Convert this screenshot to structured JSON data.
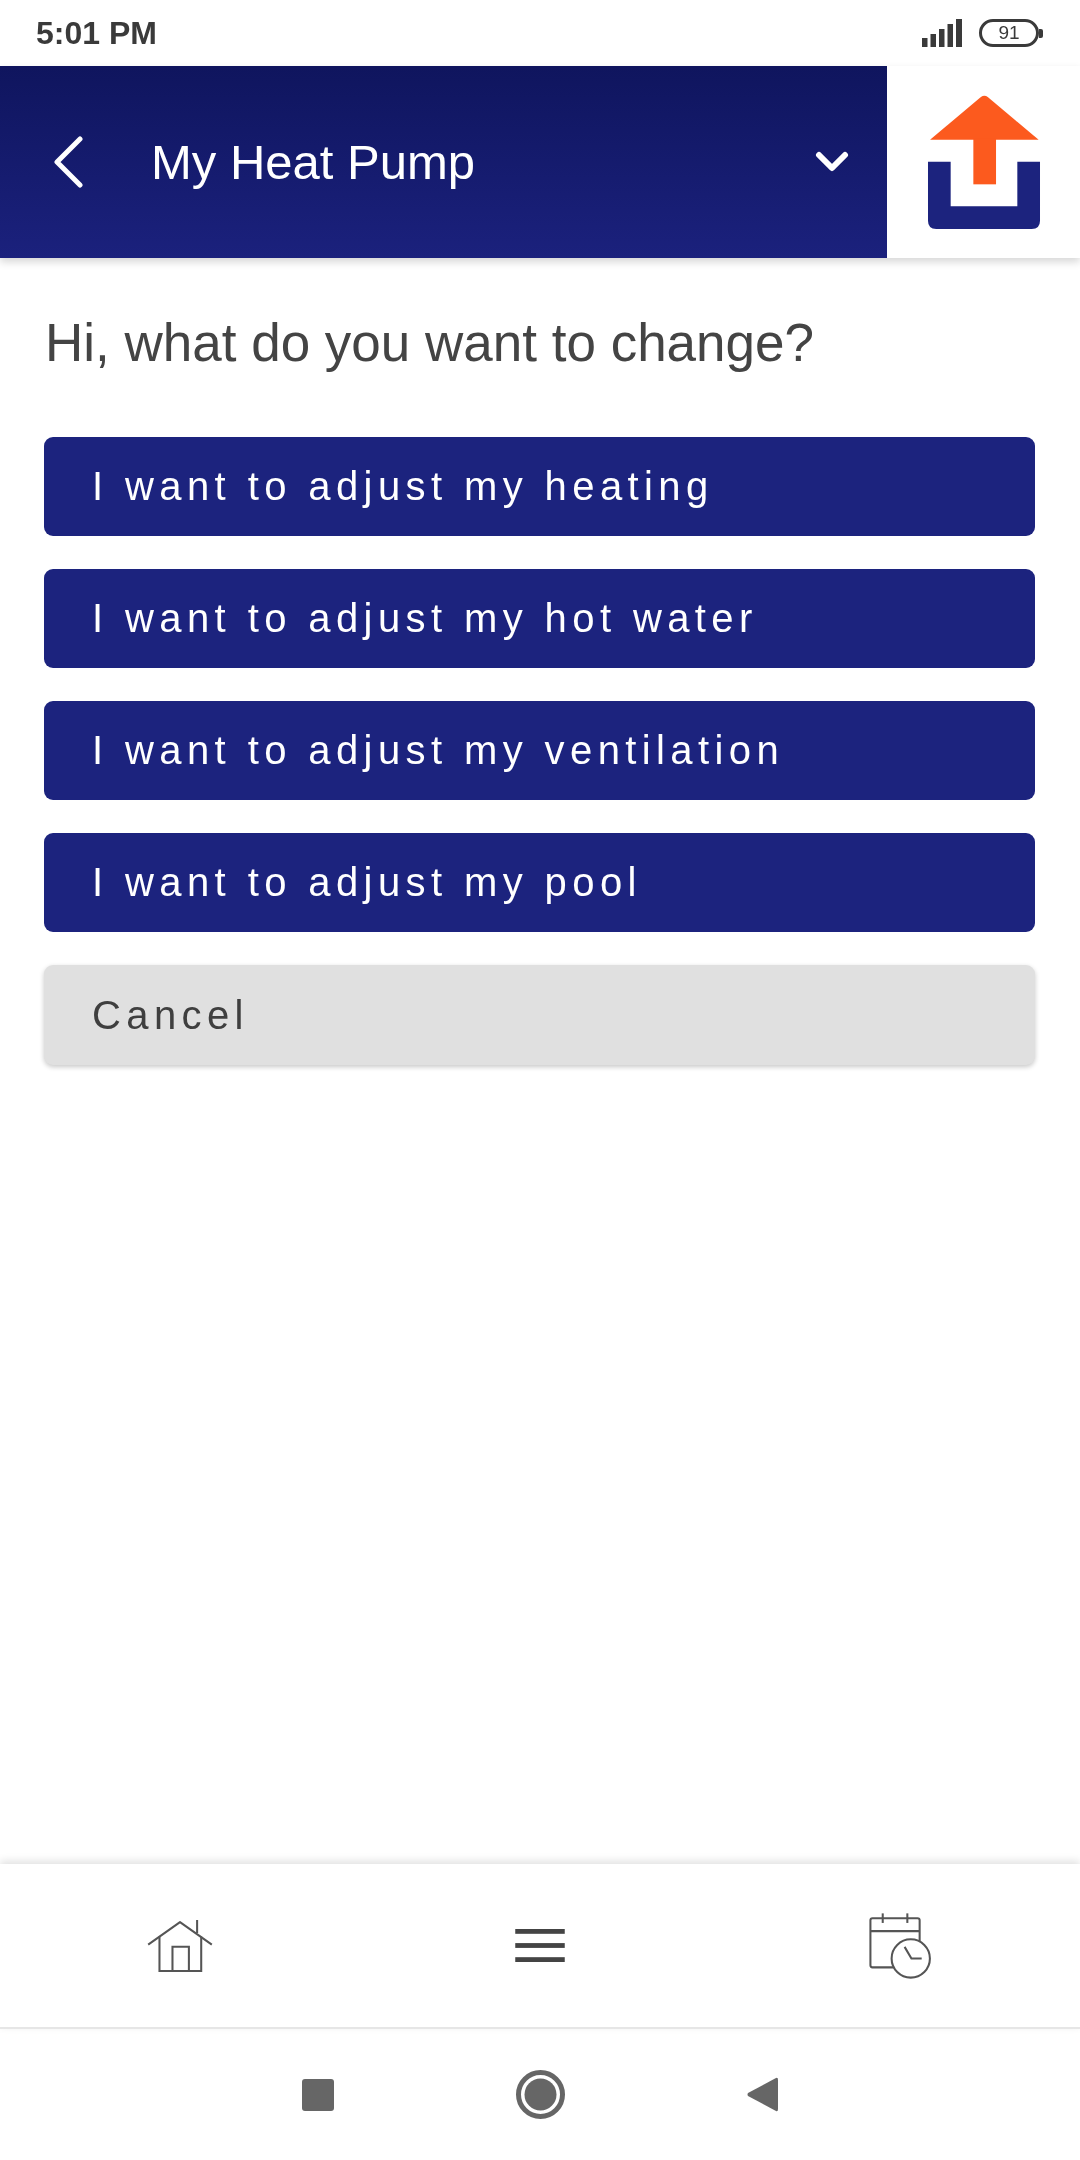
{
  "status_bar": {
    "time": "5:01 PM",
    "battery": "91"
  },
  "header": {
    "title": "My Heat Pump"
  },
  "prompt": "Hi, what do you want to change?",
  "options": [
    {
      "label": "I want to adjust my heating",
      "kind": "option"
    },
    {
      "label": "I want to adjust my hot water",
      "kind": "option"
    },
    {
      "label": "I want to adjust my ventilation",
      "kind": "option"
    },
    {
      "label": "I want to adjust my pool",
      "kind": "option"
    },
    {
      "label": "Cancel",
      "kind": "cancel"
    }
  ]
}
